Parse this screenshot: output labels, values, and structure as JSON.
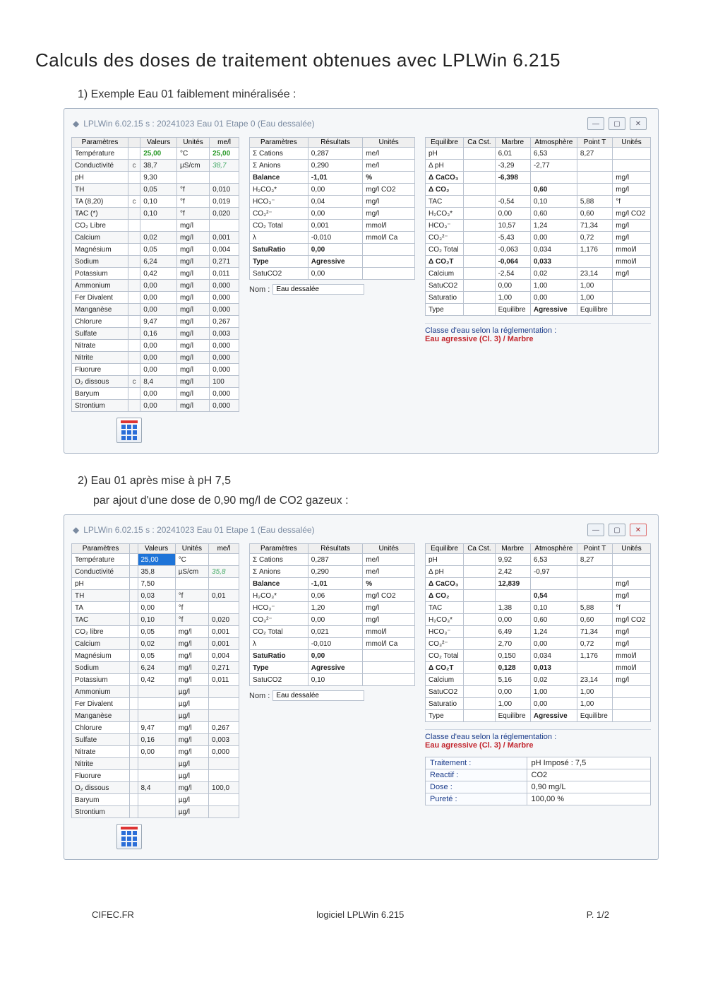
{
  "doc": {
    "title": "Calculs des doses de traitement obtenues avec LPLWin 6.215",
    "section1": "1)  Exemple Eau 01 faiblement minéralisée :",
    "section2a": "2)  Eau 01 après mise à pH 7,5",
    "section2b": "par ajout d'une dose de 0,90 mg/l de CO2 gazeux :",
    "app_title_1": "LPLWin 6.02.15 s : 20241023       Eau 01 Etape 0  (Eau dessalée)",
    "app_title_2": "LPLWin 6.02.15 s : 20241023       Eau 01 Etape 1 (Eau dessalée)",
    "nom_label": "Nom :",
    "nom_value": "Eau dessalée",
    "class_l1": "Classe d'eau selon la réglementation :",
    "class_l2": "Eau agressive (Cl. 3) / Marbre"
  },
  "hdr": {
    "paramL": "Paramètres",
    "valeurs": "Valeurs",
    "unites": "Unités",
    "mel": "me/l",
    "paramM": "Paramètres",
    "resultats": "Résultats",
    "equilibre": "Equilibre",
    "cacst": "Ca Cst.",
    "marbre": "Marbre",
    "atmo": "Atmosphère",
    "pointT": "Point T"
  },
  "left1": [
    [
      "Température",
      "",
      "25,00",
      "°C",
      "25,00",
      "hl"
    ],
    [
      "Conductivité",
      "c",
      "38,7",
      "µS/cm",
      "38,7",
      "it"
    ],
    [
      "pH",
      "",
      "9,30",
      "",
      ""
    ],
    [
      "TH",
      "",
      "0,05",
      "°f",
      "0,010"
    ],
    [
      "TA (8,20)",
      "c",
      "0,10",
      "°f",
      "0,019"
    ],
    [
      "TAC (*)",
      "",
      "0,10",
      "°f",
      "0,020"
    ],
    [
      "CO₂ Libre",
      "",
      "",
      "mg/l",
      ""
    ],
    [
      "Calcium",
      "",
      "0,02",
      "mg/l",
      "0,001"
    ],
    [
      "Magnésium",
      "",
      "0,05",
      "mg/l",
      "0,004"
    ],
    [
      "Sodium",
      "",
      "6,24",
      "mg/l",
      "0,271"
    ],
    [
      "Potassium",
      "",
      "0,42",
      "mg/l",
      "0,011"
    ],
    [
      "Ammonium",
      "",
      "0,00",
      "mg/l",
      "0,000"
    ],
    [
      "Fer Divalent",
      "",
      "0,00",
      "mg/l",
      "0,000"
    ],
    [
      "Manganèse",
      "",
      "0,00",
      "mg/l",
      "0,000"
    ],
    [
      "Chlorure",
      "",
      "9,47",
      "mg/l",
      "0,267"
    ],
    [
      "Sulfate",
      "",
      "0,16",
      "mg/l",
      "0,003"
    ],
    [
      "Nitrate",
      "",
      "0,00",
      "mg/l",
      "0,000"
    ],
    [
      "Nitrite",
      "",
      "0,00",
      "mg/l",
      "0,000"
    ],
    [
      "Fluorure",
      "",
      "0,00",
      "mg/l",
      "0,000"
    ],
    [
      "O₂ dissous",
      "c",
      "8,4",
      "mg/l",
      "100"
    ],
    [
      "Baryum",
      "",
      "0,00",
      "mg/l",
      "0,000"
    ],
    [
      "Strontium",
      "",
      "0,00",
      "mg/l",
      "0,000"
    ]
  ],
  "mid1": [
    [
      "Σ Cations",
      "0,287",
      "me/l"
    ],
    [
      "Σ Anions",
      "0,290",
      "me/l"
    ],
    [
      "Balance",
      "-1,01",
      "%",
      "b"
    ],
    [
      "H₂CO₃*",
      "0,00",
      "mg/l CO2"
    ],
    [
      "HCO₃⁻",
      "0,04",
      "mg/l"
    ],
    [
      "CO₃²⁻",
      "0,00",
      "mg/l"
    ],
    [
      "CO₂ Total",
      "0,001",
      "mmol/l"
    ],
    [
      "λ",
      "-0,010",
      "mmol/l Ca"
    ],
    [
      "SatuRatio",
      "0,00",
      "",
      "b"
    ],
    [
      "Type",
      "Agressive",
      "",
      "b"
    ],
    [
      "SatuCO2",
      "0,00",
      ""
    ]
  ],
  "right1": [
    [
      "pH",
      "",
      "6,01",
      "6,53",
      "8,27",
      ""
    ],
    [
      "Δ pH",
      "",
      "-3,29",
      "-2,77",
      "",
      ""
    ],
    [
      "Δ CaCO₃",
      "",
      "-6,398",
      "",
      "",
      "mg/l",
      "b"
    ],
    [
      "Δ CO₂",
      "",
      "",
      "0,60",
      "",
      "mg/l",
      "b"
    ],
    [
      "TAC",
      "",
      "-0,54",
      "0,10",
      "5,88",
      "°f"
    ],
    [
      "H₂CO₃*",
      "",
      "0,00",
      "0,60",
      "0,60",
      "mg/l CO2"
    ],
    [
      "HCO₃⁻",
      "",
      "10,57",
      "1,24",
      "71,34",
      "mg/l"
    ],
    [
      "CO₃²⁻",
      "",
      "-5,43",
      "0,00",
      "0,72",
      "mg/l"
    ],
    [
      "CO₂ Total",
      "",
      "-0,063",
      "0,034",
      "1,176",
      "mmol/l"
    ],
    [
      "Δ CO₂T",
      "",
      "-0,064",
      "0,033",
      "",
      "mmol/l",
      "b"
    ],
    [
      "Calcium",
      "",
      "-2,54",
      "0,02",
      "23,14",
      "mg/l"
    ],
    [
      "SatuCO2",
      "",
      "0,00",
      "1,00",
      "1,00",
      ""
    ],
    [
      "Saturatio",
      "",
      "1,00",
      "0,00",
      "1,00",
      ""
    ],
    [
      "Type",
      "",
      "Equilibre",
      "Agressive",
      "Equilibre",
      "",
      "ba"
    ]
  ],
  "left2": [
    [
      "Température",
      "",
      "25,00",
      "°C",
      "",
      "hl2"
    ],
    [
      "Conductivité",
      "",
      "35,8",
      "µS/cm",
      "35,8",
      "it"
    ],
    [
      "pH",
      "",
      "7,50",
      "",
      ""
    ],
    [
      "TH",
      "",
      "0,03",
      "°f",
      "0,01"
    ],
    [
      "TA",
      "",
      "0,00",
      "°f",
      ""
    ],
    [
      "TAC",
      "",
      "0,10",
      "°f",
      "0,020"
    ],
    [
      "CO₂ libre",
      "",
      "0,05",
      "mg/l",
      "0,001"
    ],
    [
      "Calcium",
      "",
      "0,02",
      "mg/l",
      "0,001"
    ],
    [
      "Magnésium",
      "",
      "0,05",
      "mg/l",
      "0,004"
    ],
    [
      "Sodium",
      "",
      "6,24",
      "mg/l",
      "0,271"
    ],
    [
      "Potassium",
      "",
      "0,42",
      "mg/l",
      "0,011"
    ],
    [
      "Ammonium",
      "",
      "",
      "µg/l",
      ""
    ],
    [
      "Fer Divalent",
      "",
      "",
      "µg/l",
      ""
    ],
    [
      "Manganèse",
      "",
      "",
      "µg/l",
      ""
    ],
    [
      "Chlorure",
      "",
      "9,47",
      "mg/l",
      "0,267"
    ],
    [
      "Sulfate",
      "",
      "0,16",
      "mg/l",
      "0,003"
    ],
    [
      "Nitrate",
      "",
      "0,00",
      "mg/l",
      "0,000"
    ],
    [
      "Nitrite",
      "",
      "",
      "µg/l",
      ""
    ],
    [
      "Fluorure",
      "",
      "",
      "µg/l",
      ""
    ],
    [
      "O₂ dissous",
      "",
      "8,4",
      "mg/l",
      "100,0"
    ],
    [
      "Baryum",
      "",
      "",
      "µg/l",
      ""
    ],
    [
      "Strontium",
      "",
      "",
      "µg/l",
      ""
    ]
  ],
  "mid2": [
    [
      "Σ Cations",
      "0,287",
      "me/l"
    ],
    [
      "Σ Anions",
      "0,290",
      "me/l"
    ],
    [
      "Balance",
      "-1,01",
      "%",
      "b"
    ],
    [
      "H₂CO₃*",
      "0,06",
      "mg/l CO2"
    ],
    [
      "HCO₃⁻",
      "1,20",
      "mg/l"
    ],
    [
      "CO₃²⁻",
      "0,00",
      "mg/l"
    ],
    [
      "CO₂ Total",
      "0,021",
      "mmol/l"
    ],
    [
      "λ",
      "-0,010",
      "mmol/l Ca"
    ],
    [
      "SatuRatio",
      "0,00",
      "",
      "b"
    ],
    [
      "Type",
      "Agressive",
      "",
      "b"
    ],
    [
      "SatuCO2",
      "0,10",
      ""
    ]
  ],
  "right2": [
    [
      "pH",
      "",
      "9,92",
      "6,53",
      "8,27",
      ""
    ],
    [
      "Δ pH",
      "",
      "2,42",
      "-0,97",
      "",
      ""
    ],
    [
      "Δ CaCO₃",
      "",
      "12,839",
      "",
      "",
      "mg/l",
      "b"
    ],
    [
      "Δ CO₂",
      "",
      "",
      "0,54",
      "",
      "mg/l",
      "b"
    ],
    [
      "TAC",
      "",
      "1,38",
      "0,10",
      "5,88",
      "°f"
    ],
    [
      "H₂CO₃*",
      "",
      "0,00",
      "0,60",
      "0,60",
      "mg/l CO2"
    ],
    [
      "HCO₃⁻",
      "",
      "6,49",
      "1,24",
      "71,34",
      "mg/l"
    ],
    [
      "CO₃²⁻",
      "",
      "2,70",
      "0,00",
      "0,72",
      "mg/l"
    ],
    [
      "CO₂ Total",
      "",
      "0,150",
      "0,034",
      "1,176",
      "mmol/l"
    ],
    [
      "Δ CO₂T",
      "",
      "0,128",
      "0,013",
      "",
      "mmol/l",
      "b"
    ],
    [
      "Calcium",
      "",
      "5,16",
      "0,02",
      "23,14",
      "mg/l"
    ],
    [
      "SatuCO2",
      "",
      "0,00",
      "1,00",
      "1,00",
      ""
    ],
    [
      "Saturatio",
      "",
      "1,00",
      "0,00",
      "1,00",
      ""
    ],
    [
      "Type",
      "",
      "Equilibre",
      "Agressive",
      "Equilibre",
      "",
      "ba"
    ]
  ],
  "treatment": [
    [
      "Traitement :",
      "pH Imposé : 7,5"
    ],
    [
      "Reactif :",
      "CO2"
    ],
    [
      "Dose :",
      "0,90 mg/L"
    ],
    [
      "Pureté :",
      "100,00 %"
    ]
  ],
  "footer": {
    "left": "CIFEC.FR",
    "mid": "logiciel LPLWin 6.215",
    "right": "P. 1/2"
  }
}
